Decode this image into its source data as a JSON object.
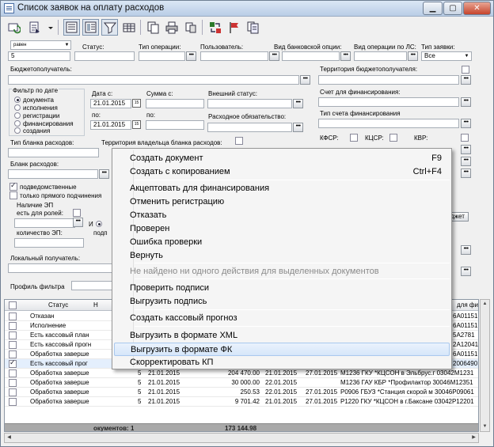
{
  "window": {
    "title": "Список заявок на оплату расходов"
  },
  "filters": {
    "top_left_combo": "равен",
    "top_left_value": "5",
    "status_label": "Статус:",
    "op_type_label": "Тип операции:",
    "user_label": "Пользователь:",
    "bank_op_label": "Вид банковской опции:",
    "ls_op_label": "Вид операции по ЛС:",
    "request_type_label": "Тип заявки:",
    "request_type_value": "Все",
    "budget_recipient_label": "Бюджетополучатель:",
    "budget_territory_label": "Территория бюджетополучателя:",
    "date_filter_label": "Фильтр по дате",
    "date_options": [
      "документа",
      "исполнения",
      "регистрации",
      "финансирования",
      "создания"
    ],
    "date_from_label": "Дата с:",
    "date_from": "21.01.2015",
    "date_to_label": "по:",
    "date_to": "21.01.2015",
    "sum_from_label": "Сумма с:",
    "sum_to_label": "по:",
    "external_status_label": "Внешний статус:",
    "expense_obligation_label": "Расходное обязательство:",
    "fin_account_label": "Счет для финансирования:",
    "fin_account_type_label": "Тип счета финансирования",
    "kfsr_label": "КФСР:",
    "kcsr_label": "КЦСР:",
    "kvr_label": "КВР:",
    "blank_type_label": "Тип бланка расходов:",
    "blank_owner_territory_label": "Территория владельца бланка расходов:",
    "blank_label": "Бланк расходов:",
    "subordinate_label": "подведомственные",
    "direct_only_label": "только прямого подчинения",
    "ep_presence_label": "Наличие ЭП",
    "ep_roles_label": "есть для ролей:",
    "ep_and_label": "И",
    "ep_sign_partial": "подп",
    "ep_count_label": "количество ЭП:",
    "local_recipient_label": "Локальный получатель:",
    "budget_button_partial": "джет",
    "filter_profile_label": "Профиль фильтра"
  },
  "grid": {
    "columns": [
      "Статус",
      "Н",
      "для фи"
    ],
    "rows": [
      {
        "status": "Отказан",
        "n": "",
        "date": "",
        "sum": "",
        "d2": "",
        "d3": "",
        "text": "",
        "right": "6A01151",
        "checked": false
      },
      {
        "status": "Исполнение",
        "n": "",
        "date": "",
        "sum": "",
        "d2": "",
        "d3": "",
        "text": "",
        "right": "6A01151",
        "checked": false
      },
      {
        "status": "Есть кассовый план",
        "n": "",
        "date": "",
        "sum": "",
        "d2": "",
        "d3": "",
        "text": "",
        "right": "5A2781",
        "checked": false
      },
      {
        "status": "Есть кассовый прогн",
        "n": "",
        "date": "",
        "sum": "",
        "d2": "",
        "d3": "",
        "text": "",
        "right": "2A12041",
        "checked": false
      },
      {
        "status": "Обработка заверше",
        "n": "",
        "date": "",
        "sum": "",
        "d2": "",
        "d3": "",
        "text": "",
        "right": "6A01151",
        "checked": false
      },
      {
        "status": "Есть кассовый прог",
        "n": "",
        "date": "",
        "sum": "",
        "d2": "",
        "d3": "",
        "text": "",
        "right": "2006490",
        "checked": true
      },
      {
        "status": "Обработка заверше",
        "n": "5",
        "date": "21.01.2015",
        "sum": "204 470.00",
        "d2": "21.01.2015",
        "d3": "27.01.2015",
        "text": "М1236 ГКУ *КЦСОН в Эльбрус.г 03042М1231",
        "right": "",
        "checked": false
      },
      {
        "status": "Обработка заверше",
        "n": "5",
        "date": "21.01.2015",
        "sum": "30 000.00",
        "d2": "22.01.2015",
        "d3": "",
        "text": "М1236 ГАУ КБР *Профилактор 30046М12351",
        "right": "",
        "checked": false
      },
      {
        "status": "Обработка заверше",
        "n": "5",
        "date": "21.01.2015",
        "sum": "250.53",
        "d2": "22.01.2015",
        "d3": "27.01.2015",
        "text": "Р0906 ГБУЗ *Станция скорой м 30046Р09061",
        "right": "",
        "checked": false
      },
      {
        "status": "Обработка заверше",
        "n": "5",
        "date": "21.01.2015",
        "sum": "9 701.42",
        "d2": "21.01.2015",
        "d3": "27.01.2015",
        "text": "Р1220 ГКУ *КЦСОН в г.Баксане 03042Р12201",
        "right": "",
        "checked": false
      }
    ],
    "footer_count": "окументов: 1",
    "footer_sum": "173 144.98"
  },
  "context_menu": {
    "items": [
      {
        "label": "Создать документ",
        "shortcut": "F9",
        "disabled": false,
        "highlight": false
      },
      {
        "label": "Создать с копированием",
        "shortcut": "Ctrl+F4",
        "disabled": false,
        "highlight": false
      },
      {
        "label": "Акцептовать для финансирования",
        "shortcut": "",
        "disabled": false,
        "highlight": false
      },
      {
        "label": "Отменить регистрацию",
        "shortcut": "",
        "disabled": false,
        "highlight": false
      },
      {
        "label": "Отказать",
        "shortcut": "",
        "disabled": false,
        "highlight": false
      },
      {
        "label": "Проверен",
        "shortcut": "",
        "disabled": false,
        "highlight": false
      },
      {
        "label": "Ошибка проверки",
        "shortcut": "",
        "disabled": false,
        "highlight": false
      },
      {
        "label": "Вернуть",
        "shortcut": "",
        "disabled": false,
        "highlight": false
      },
      {
        "label": "Не найдено ни одного действия для выделенных документов",
        "shortcut": "",
        "disabled": true,
        "highlight": false
      },
      {
        "label": "Проверить подписи",
        "shortcut": "",
        "disabled": false,
        "highlight": false
      },
      {
        "label": "Выгрузить подпись",
        "shortcut": "",
        "disabled": false,
        "highlight": false
      },
      {
        "label": "Создать кассовый прогноз",
        "shortcut": "",
        "disabled": false,
        "highlight": false
      },
      {
        "label": "Выгрузить в формате XML",
        "shortcut": "",
        "disabled": false,
        "highlight": false
      },
      {
        "label": "Выгрузить в формате ФК",
        "shortcut": "",
        "disabled": false,
        "highlight": true
      },
      {
        "label": "Скорректировать КП",
        "shortcut": "",
        "disabled": false,
        "highlight": false
      }
    ]
  },
  "icons": {
    "toolbar": [
      "refresh-icon",
      "export-icon",
      "dropdown-arrow-icon",
      "view-icon",
      "form-view-icon",
      "filter-icon",
      "grid-icon",
      "copy-icon",
      "print-icon",
      "duplicate-icon",
      "arrows-icon",
      "flag-icon",
      "documents-icon"
    ],
    "window_buttons": [
      "minimize-icon",
      "maximize-icon",
      "close-icon"
    ]
  },
  "colors": {
    "selection": "#e4effd",
    "highlight_border": "#a9c8ee",
    "footer": "#a9a9a9"
  }
}
